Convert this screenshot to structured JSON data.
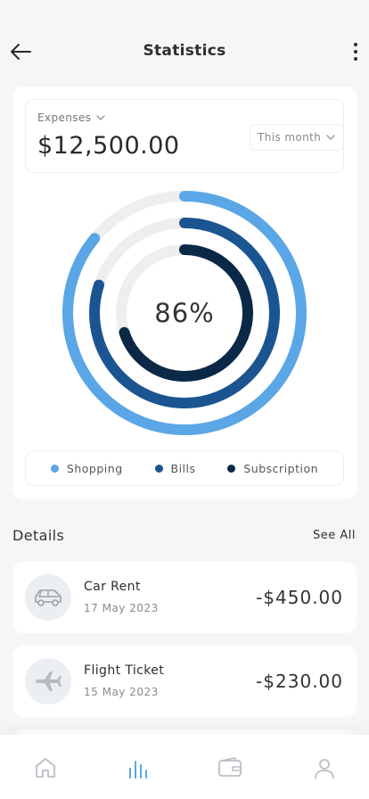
{
  "header": {
    "title": "Statistics"
  },
  "summary": {
    "category_label": "Expenses",
    "amount": "$12,500.00",
    "period": "This month"
  },
  "chart_data": {
    "type": "radial-bar",
    "center_label": "86%",
    "series": [
      {
        "name": "Shopping",
        "value": 0.86,
        "color": "#5aa6e6"
      },
      {
        "name": "Bills",
        "value": 0.8,
        "color": "#1b5591"
      },
      {
        "name": "Subscription",
        "value": 0.7,
        "color": "#0b2847"
      }
    ],
    "track_color": "#eeeeee"
  },
  "legend": [
    {
      "label": "Shopping",
      "color": "#5aa6e6"
    },
    {
      "label": "Bills",
      "color": "#1b5591"
    },
    {
      "label": "Subscription",
      "color": "#0b2847"
    }
  ],
  "details": {
    "title": "Details",
    "see_all": "See All",
    "items": [
      {
        "name": "Car Rent",
        "date": "17 May 2023",
        "amount": "-$450.00",
        "icon": "car-icon"
      },
      {
        "name": "Flight Ticket",
        "date": "15 May 2023",
        "amount": "-$230.00",
        "icon": "airplane-icon"
      }
    ]
  },
  "nav": {
    "items": [
      "home-icon",
      "statistics-icon",
      "wallet-icon",
      "profile-icon"
    ],
    "active": "statistics-icon",
    "active_color": "#5aa6e6",
    "inactive_color": "#b9bec5"
  }
}
